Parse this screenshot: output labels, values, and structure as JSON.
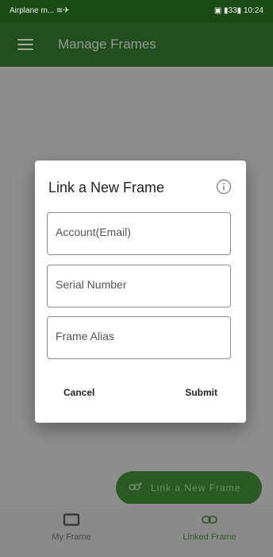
{
  "status_bar": {
    "left_text": "Airplane m... ≋✈",
    "right_text": "▣ ▮33▮ 10:24"
  },
  "app_bar": {
    "title": "Manage Frames",
    "menu_icon": "hamburger-menu-icon"
  },
  "dialog": {
    "title": "Link a New Frame",
    "info_icon": "info-circle-icon",
    "fields": [
      {
        "placeholder": "Account(Email)",
        "value": ""
      },
      {
        "placeholder": "Serial Number",
        "value": ""
      },
      {
        "placeholder": "Frame Alias",
        "value": ""
      }
    ],
    "cancel_label": "Cancel",
    "submit_label": "Submit"
  },
  "fab": {
    "label": "Link a New Frame",
    "icon": "link-add-icon"
  },
  "bottom_nav": {
    "items": [
      {
        "label": "My Frame",
        "icon": "frame-icon",
        "active": false
      },
      {
        "label": "Linked Frame",
        "icon": "link-icon",
        "active": true
      }
    ]
  },
  "colors": {
    "primary": "#244e1f",
    "scrim": "#8e8e8e",
    "dialog_bg": "#ffffff"
  }
}
